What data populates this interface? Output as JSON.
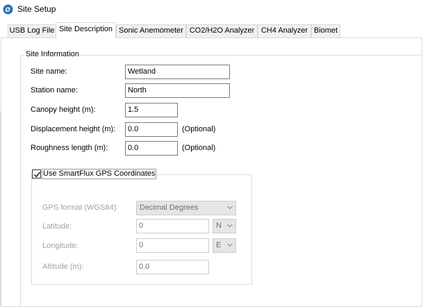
{
  "window": {
    "title": "Site Setup",
    "icon": "app-logo-icon"
  },
  "tabs": [
    {
      "label": "USB Log File"
    },
    {
      "label": "Site Description"
    },
    {
      "label": "Sonic Anemometer"
    },
    {
      "label": "CO2/H2O Analyzer"
    },
    {
      "label": "CH4 Analyzer"
    },
    {
      "label": "Biomet"
    }
  ],
  "active_tab": "Site Description",
  "site_info": {
    "group_title": "Site Information",
    "site_name_label": "Site name:",
    "site_name_value": "Wetland",
    "station_name_label": "Station name:",
    "station_name_value": "North",
    "canopy_label": "Canopy height (m):",
    "canopy_value": "1.5",
    "displacement_label": "Displacement height (m):",
    "displacement_value": "0.0",
    "displacement_note": "(Optional)",
    "roughness_label": "Roughness length (m):",
    "roughness_value": "0.0",
    "roughness_note": "(Optional)"
  },
  "gps": {
    "checkbox_label": "Use SmartFlux GPS Coordinates",
    "checked": true,
    "format_label": "GPS format (WGS84):",
    "format_value": "Decimal Degrees",
    "latitude_label": "Latitude:",
    "latitude_value": "0",
    "latitude_dir": "N",
    "longitude_label": "Longitude:",
    "longitude_value": "0",
    "longitude_dir": "E",
    "altitude_label": "Altitude (m):",
    "altitude_value": "0.0"
  }
}
